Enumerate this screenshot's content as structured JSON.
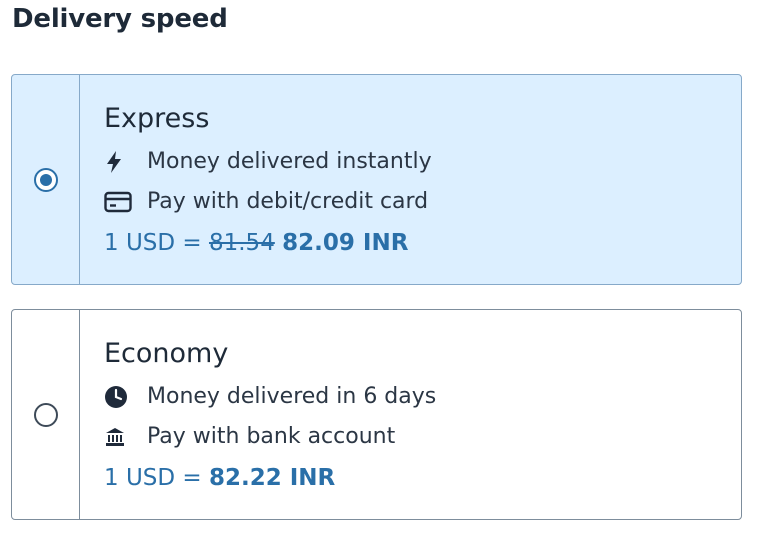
{
  "heading": "Delivery speed",
  "options": [
    {
      "name": "Express",
      "selected": true,
      "features": [
        {
          "icon": "lightning-icon",
          "text": "Money delivered instantly"
        },
        {
          "icon": "credit-card-icon",
          "text": "Pay with debit/credit card"
        }
      ],
      "rate_prefix": "1 USD = ",
      "rate_old": "81.54",
      "rate_new": "82.09 INR"
    },
    {
      "name": "Economy",
      "selected": false,
      "features": [
        {
          "icon": "clock-icon",
          "text": "Money delivered in 6 days"
        },
        {
          "icon": "bank-icon",
          "text": "Pay with bank account"
        }
      ],
      "rate_prefix": "1 USD = ",
      "rate_new": "82.22 INR"
    }
  ],
  "colors": {
    "accent": "#2a6fa8",
    "selected_bg": "#dcefff",
    "border": "#7d8d9c",
    "text": "#1e2a38"
  }
}
